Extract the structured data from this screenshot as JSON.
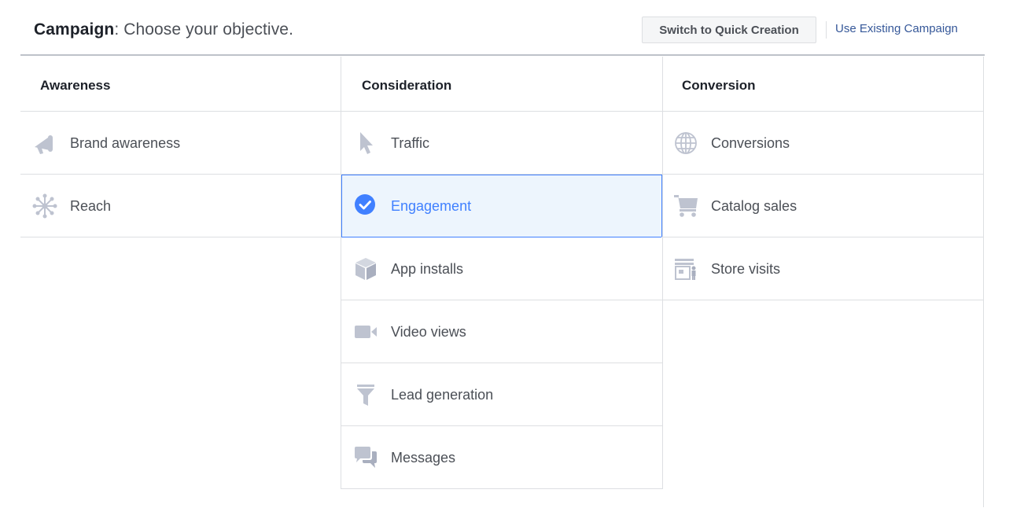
{
  "header": {
    "title_bold": "Campaign",
    "title_rest": ": Choose your objective.",
    "switch_label": "Switch to Quick Creation",
    "existing_label": "Use Existing Campaign"
  },
  "columns": [
    {
      "heading": "Awareness",
      "items": [
        {
          "label": "Brand awareness",
          "icon": "megaphone-icon"
        },
        {
          "label": "Reach",
          "icon": "reach-icon"
        }
      ]
    },
    {
      "heading": "Consideration",
      "items": [
        {
          "label": "Traffic",
          "icon": "cursor-icon"
        },
        {
          "label": "Engagement",
          "icon": "checkmark-circle-icon",
          "selected": true
        },
        {
          "label": "App installs",
          "icon": "box-icon"
        },
        {
          "label": "Video views",
          "icon": "video-camera-icon"
        },
        {
          "label": "Lead generation",
          "icon": "funnel-icon"
        },
        {
          "label": "Messages",
          "icon": "chat-bubbles-icon"
        }
      ]
    },
    {
      "heading": "Conversion",
      "items": [
        {
          "label": "Conversions",
          "icon": "globe-icon"
        },
        {
          "label": "Catalog sales",
          "icon": "cart-icon"
        },
        {
          "label": "Store visits",
          "icon": "store-icon"
        }
      ]
    }
  ],
  "colors": {
    "selected_accent": "#4080ff",
    "selected_bg": "#edf5fd",
    "icon_gray": "#bec3d0",
    "link": "#365899"
  }
}
